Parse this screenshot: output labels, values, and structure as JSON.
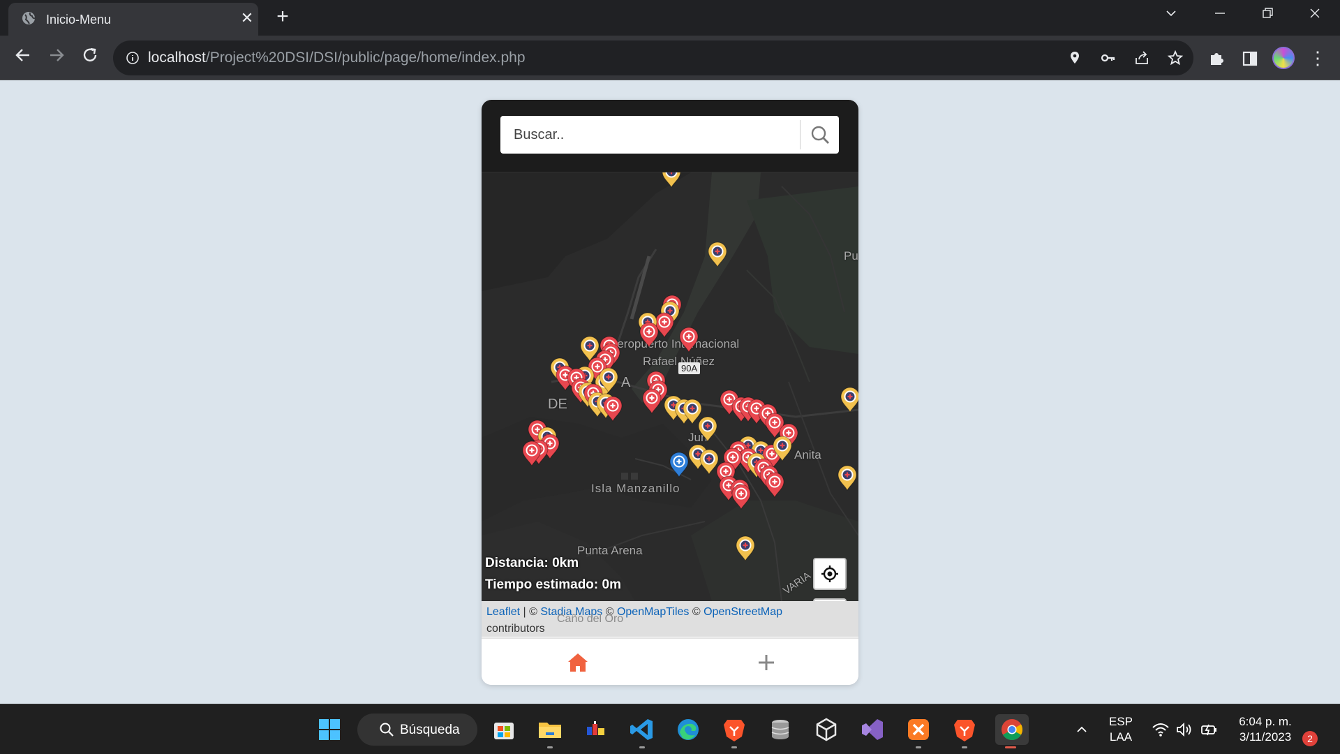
{
  "browser": {
    "tab_title": "Inicio-Menu",
    "url_host": "localhost",
    "url_path": "/Project%20DSI/DSI/public/page/home/index.php"
  },
  "app": {
    "search_placeholder": "Buscar..",
    "map_labels": {
      "airport_1": "Aeropuerto Internacional",
      "airport_2": "Rafael Núñez",
      "road_shield": "90A",
      "isla": "Isla Manzanillo",
      "punta_arena": "Punta Arena",
      "cano_del_oro": "Caño del Oro",
      "juan": "Jun",
      "anita": "Anita",
      "de": "DE",
      "a": "A",
      "pu": "Pu",
      "variante": "VARIA"
    },
    "distance_text": "Distancia: 0km",
    "time_text": "Tiempo estimado: 0m",
    "attribution": {
      "leaflet": "Leaflet",
      "sep1": " | © ",
      "stadia": "Stadia Maps",
      "sep2": " © ",
      "omt": "OpenMapTiles",
      "sep3": " © ",
      "osm": "OpenStreetMap",
      "contrib": "contributors"
    },
    "zoom_in_label": "+",
    "zoom_out_label": "–",
    "colors": {
      "red_marker": "#e8474f",
      "yellow_marker": "#f2c14e",
      "blue_marker": "#2f7fd9",
      "home_accent": "#f0623f"
    }
  },
  "taskbar": {
    "search_label": "Búsqueda",
    "lang_1": "ESP",
    "lang_2": "LAA",
    "time": "6:04 p. m.",
    "date": "3/11/2023",
    "notifications": "2"
  }
}
